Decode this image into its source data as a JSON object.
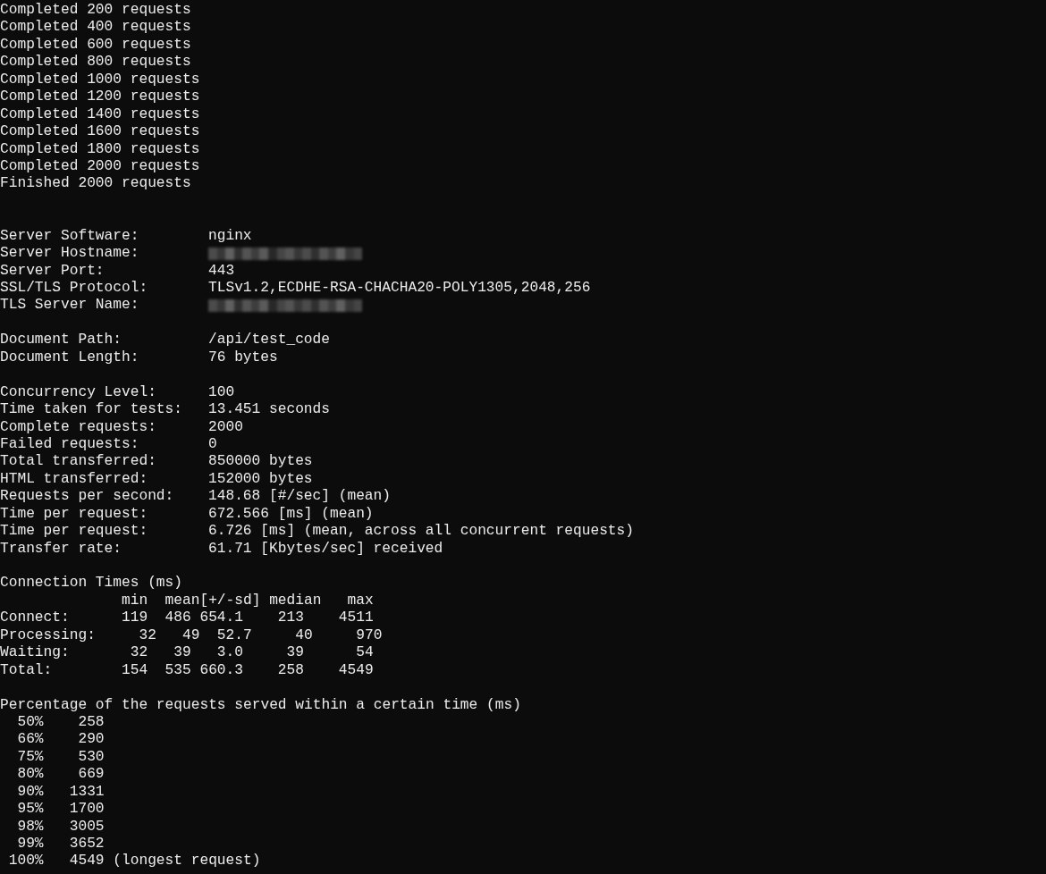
{
  "lines": [
    {
      "kind": "text",
      "text": "Completed 200 requests"
    },
    {
      "kind": "text",
      "text": "Completed 400 requests"
    },
    {
      "kind": "text",
      "text": "Completed 600 requests"
    },
    {
      "kind": "text",
      "text": "Completed 800 requests"
    },
    {
      "kind": "text",
      "text": "Completed 1000 requests"
    },
    {
      "kind": "text",
      "text": "Completed 1200 requests"
    },
    {
      "kind": "text",
      "text": "Completed 1400 requests"
    },
    {
      "kind": "text",
      "text": "Completed 1600 requests"
    },
    {
      "kind": "text",
      "text": "Completed 1800 requests"
    },
    {
      "kind": "text",
      "text": "Completed 2000 requests"
    },
    {
      "kind": "text",
      "text": "Finished 2000 requests"
    },
    {
      "kind": "blank"
    },
    {
      "kind": "blank"
    },
    {
      "kind": "field",
      "label": "Server Software:",
      "value": "nginx",
      "redacted": false
    },
    {
      "kind": "field",
      "label": "Server Hostname:",
      "redacted": true
    },
    {
      "kind": "field",
      "label": "Server Port:",
      "value": "443",
      "redacted": false
    },
    {
      "kind": "field",
      "label": "SSL/TLS Protocol:",
      "value": "TLSv1.2,ECDHE-RSA-CHACHA20-POLY1305,2048,256",
      "redacted": false
    },
    {
      "kind": "field",
      "label": "TLS Server Name:",
      "redacted": true
    },
    {
      "kind": "blank"
    },
    {
      "kind": "field",
      "label": "Document Path:",
      "value": "/api/test_code",
      "redacted": false
    },
    {
      "kind": "field",
      "label": "Document Length:",
      "value": "76 bytes",
      "redacted": false
    },
    {
      "kind": "blank"
    },
    {
      "kind": "field",
      "label": "Concurrency Level:",
      "value": "100",
      "redacted": false
    },
    {
      "kind": "field",
      "label": "Time taken for tests:",
      "value": "13.451 seconds",
      "redacted": false
    },
    {
      "kind": "field",
      "label": "Complete requests:",
      "value": "2000",
      "redacted": false
    },
    {
      "kind": "field",
      "label": "Failed requests:",
      "value": "0",
      "redacted": false
    },
    {
      "kind": "field",
      "label": "Total transferred:",
      "value": "850000 bytes",
      "redacted": false
    },
    {
      "kind": "field",
      "label": "HTML transferred:",
      "value": "152000 bytes",
      "redacted": false
    },
    {
      "kind": "field",
      "label": "Requests per second:",
      "value": "148.68 [#/sec] (mean)",
      "redacted": false
    },
    {
      "kind": "field",
      "label": "Time per request:",
      "value": "672.566 [ms] (mean)",
      "redacted": false
    },
    {
      "kind": "field",
      "label": "Time per request:",
      "value": "6.726 [ms] (mean, across all concurrent requests)",
      "redacted": false
    },
    {
      "kind": "field",
      "label": "Transfer rate:",
      "value": "61.71 [Kbytes/sec] received",
      "redacted": false
    },
    {
      "kind": "blank"
    },
    {
      "kind": "text",
      "text": "Connection Times (ms)"
    },
    {
      "kind": "text",
      "text": "              min  mean[+/-sd] median   max"
    },
    {
      "kind": "text",
      "text": "Connect:      119  486 654.1    213    4511"
    },
    {
      "kind": "text",
      "text": "Processing:     32   49  52.7     40     970"
    },
    {
      "kind": "text",
      "text": "Waiting:       32   39   3.0     39      54"
    },
    {
      "kind": "text",
      "text": "Total:        154  535 660.3    258    4549"
    },
    {
      "kind": "blank"
    },
    {
      "kind": "text",
      "text": "Percentage of the requests served within a certain time (ms)"
    },
    {
      "kind": "text",
      "text": "  50%    258"
    },
    {
      "kind": "text",
      "text": "  66%    290"
    },
    {
      "kind": "text",
      "text": "  75%    530"
    },
    {
      "kind": "text",
      "text": "  80%    669"
    },
    {
      "kind": "text",
      "text": "  90%   1331"
    },
    {
      "kind": "text",
      "text": "  95%   1700"
    },
    {
      "kind": "text",
      "text": "  98%   3005"
    },
    {
      "kind": "text",
      "text": "  99%   3652"
    },
    {
      "kind": "text",
      "text": " 100%   4549 (longest request)"
    }
  ]
}
